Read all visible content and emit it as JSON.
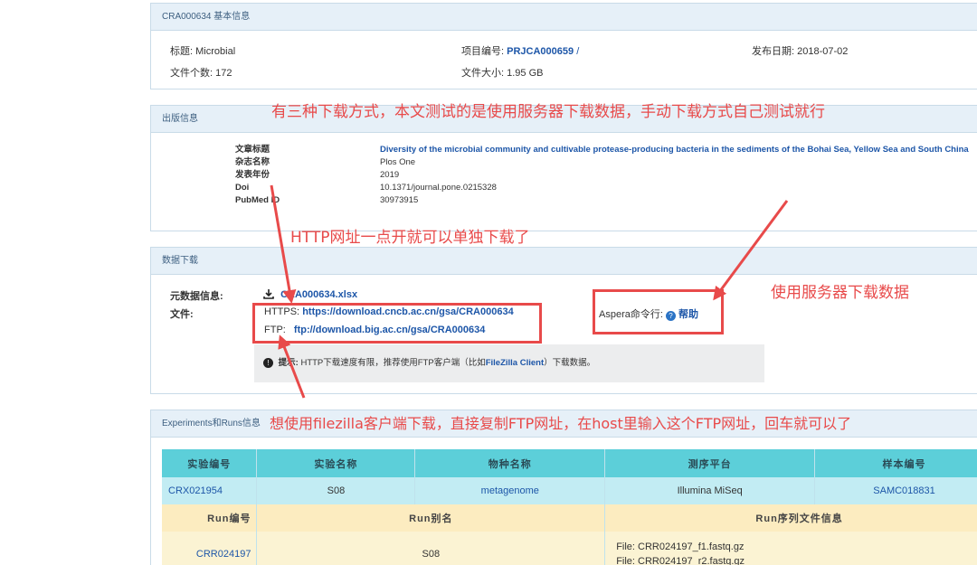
{
  "basic": {
    "header": "CRA000634 基本信息",
    "title_label": "标题:",
    "title_value": "Microbial",
    "project_label": "项目编号:",
    "project_value": "PRJCA000659",
    "project_sep": "/",
    "release_label": "发布日期:",
    "release_value": "2018-07-02",
    "filecount_label": "文件个数:",
    "filecount_value": "172",
    "filesize_label": "文件大小:",
    "filesize_value": "1.95 GB"
  },
  "publication": {
    "header": "出版信息",
    "rows": [
      {
        "key": "文章标题",
        "value": "Diversity of the microbial community and cultivable protease-producing bacteria in the sediments of the Bohai Sea, Yellow Sea and South China"
      },
      {
        "key": "杂志名称",
        "value": "Plos One"
      },
      {
        "key": "发表年份",
        "value": "2019"
      },
      {
        "key": "Doi",
        "value": "10.1371/journal.pone.0215328"
      },
      {
        "key": "PubMed ID",
        "value": "30973915"
      }
    ]
  },
  "download": {
    "header": "数据下载",
    "meta_label": "元数据信息:",
    "meta_file": "CRA000634.xlsx",
    "file_label": "文件:",
    "https_label": "HTTPS:",
    "https_url": "https://download.cncb.ac.cn/gsa/CRA000634",
    "ftp_label": "FTP:",
    "ftp_url": "ftp://download.big.ac.cn/gsa/CRA000634",
    "aspera_label": "Aspera命令行:",
    "help_label": "帮助",
    "tip_prefix": "提示:",
    "tip_text": "HTTP下载速度有限，推荐使用FTP客户端（比如",
    "tip_link": "FileZilla Client",
    "tip_suffix": "）下载数据。"
  },
  "experiments": {
    "header": "Experiments和Runs信息",
    "exp_headers": [
      "实验编号",
      "实验名称",
      "物种名称",
      "测序平台",
      "样本编号"
    ],
    "exp_row": [
      "CRX021954",
      "S08",
      "metagenome",
      "Illumina MiSeq",
      "SAMC018831"
    ],
    "run_headers": [
      "Run编号",
      "Run别名",
      "Run序列文件信息"
    ],
    "run_id": "CRR024197",
    "run_alias": "S08",
    "run_files": [
      "File: CRR024197_f1.fastq.gz",
      "File: CRR024197_r2.fastq.gz"
    ]
  },
  "annotations": {
    "top": "有三种下载方式，本文测试的是使用服务器下载数据，手动下载方式自己测试就行",
    "http": "HTTP网址一点开就可以单独下载了",
    "server": "使用服务器下载数据",
    "filezilla": "想使用filezilla客户端下载，直接复制FTP网址，在host里输入这个FTP网址，回车就可以了"
  },
  "colors": {
    "annotation": "#e84a4a",
    "link": "#1d56a8",
    "header_teal": "#5ccfd9",
    "row_yellow": "#fcecc0"
  }
}
